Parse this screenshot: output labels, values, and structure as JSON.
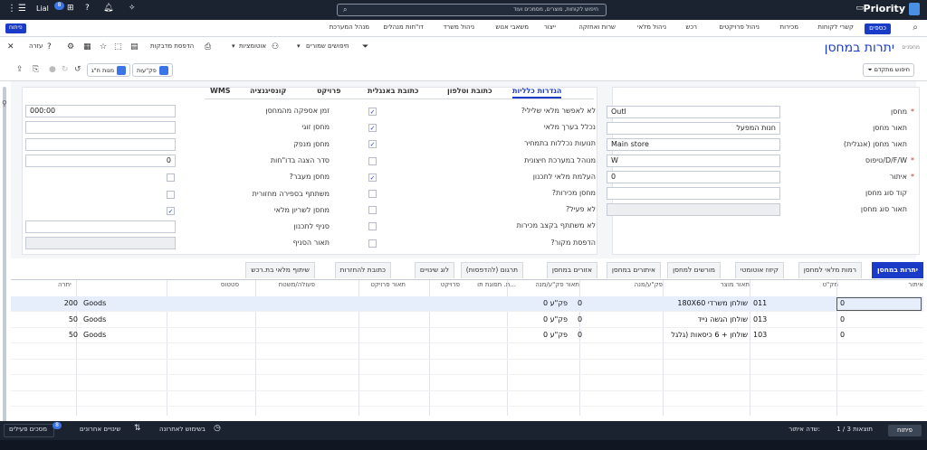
{
  "topbar": {
    "app_name": "Priority",
    "search_placeholder": "חיפוש לקוחות, מוצרים, מסמכים ועוד",
    "user_initials": "Lial",
    "badge_count": "8"
  },
  "menu": {
    "items": [
      "כספים",
      "קשרי לקוחות",
      "מכירות",
      "ניהול פרויקטים",
      "רכש",
      "ניהול מלאי",
      "שרות ואחזקה",
      "ייצור",
      "משאבי אנוש",
      "ניהול משרד",
      "דו\"חות מנהלים",
      "מנהל המערכת"
    ],
    "pill": "פיתוח"
  },
  "toolbar": {
    "title": "יתרות במחסן",
    "breadcrumb": "מחסנים",
    "saved_searches": "חיפושים שמורים",
    "automation": "אוטומציות",
    "print_labels": "הדפסת מדבקות",
    "help": "עזרה",
    "advanced_search": "חיפוש מתקדם",
    "btn_pakat": "פק\"עות",
    "btn_ch": "מנות ח\"ג"
  },
  "form_tabs": [
    "הגדרות כלליות",
    "כתובת וטלפון",
    "כתובת באנגלית",
    "פרויקט",
    "קונסיגנציה",
    "WMS"
  ],
  "right_fields": [
    {
      "label": "מחסן",
      "value": "Outl",
      "required": true,
      "readonly": false
    },
    {
      "label": "תאור מחסן",
      "value": "חנות המפעל",
      "required": false,
      "readonly": false
    },
    {
      "label": "תאור מחסן (אנגלית)",
      "value": "Main store",
      "required": false,
      "readonly": false
    },
    {
      "label": "D/F/W/טיפוס",
      "value": "W",
      "required": true,
      "readonly": false
    },
    {
      "label": "איתור",
      "value": "0",
      "required": true,
      "readonly": false
    },
    {
      "label": "קוד סוג מחסן",
      "value": "",
      "required": false,
      "readonly": false
    },
    {
      "label": "תאור סוג מחסן",
      "value": "",
      "required": false,
      "readonly": true
    }
  ],
  "middle_checks": [
    {
      "label": "לא לאפשר מלאי שלילי?",
      "checked": true
    },
    {
      "label": "נכלל בערך מלאי",
      "checked": true
    },
    {
      "label": "תנועות נכללות בתמחיר",
      "checked": true
    },
    {
      "label": "מנוהל במערכת חיצונית",
      "checked": false
    },
    {
      "label": "העלמת מלאי לתכנון",
      "checked": true
    },
    {
      "label": "מחסן מכירות?",
      "checked": false
    },
    {
      "label": "לא פעיל?",
      "checked": false
    },
    {
      "label": "לא משתתף בקצב מכירות",
      "checked": false
    },
    {
      "label": "הדפסת מקור?",
      "checked": false
    }
  ],
  "left_fields": [
    {
      "label": "זמן אספקה מהמחסן",
      "kind": "input",
      "value": "000:00"
    },
    {
      "label": "מחסן זוגי",
      "kind": "input",
      "value": ""
    },
    {
      "label": "מחסן מנפק",
      "kind": "input",
      "value": ""
    },
    {
      "label": "סדר הצגה בדו\"חות",
      "kind": "input",
      "value": "0"
    },
    {
      "label": "מחסן מעבר?",
      "kind": "check",
      "checked": false
    },
    {
      "label": "משתתף בספירה מחזורית",
      "kind": "check",
      "checked": false
    },
    {
      "label": "מחסן לשריון מלאי",
      "kind": "check",
      "checked": true
    },
    {
      "label": "סניף לתכנון",
      "kind": "input",
      "value": ""
    },
    {
      "label": "תאור הסניף",
      "kind": "input",
      "value": "",
      "readonly": true
    }
  ],
  "sub_tabs": [
    "יתרות במחסן",
    "רמות מלאי למחסן",
    "קיזוז אוטומטי",
    "מורשים למחסן",
    "איתורים במחסן",
    "אזורים במחסן",
    "תרגום (להדפסות)",
    "לוג שינויים",
    "כתובת להחזרות",
    "שיתוף מלאי בת.רכש"
  ],
  "grid": {
    "headers": [
      "איתור",
      "מק\"ט",
      "תאור מוצר",
      "פק\"ע/מנה",
      "תאור פק\"ע/מנה",
      "ת. תפוגת תו...",
      "פרויקט",
      "תאור פרויקט",
      "פעולה/משטח",
      "סטטוס",
      "יתרה"
    ],
    "rows": [
      {
        "location": "0",
        "sku": "011",
        "desc": "שולחן משרדי 180X60",
        "lot": "0",
        "lot_desc": "פק\"ע 0",
        "status": "Goods",
        "qty": "200"
      },
      {
        "location": "0",
        "sku": "013",
        "desc": "שולחן הגשה נייד",
        "lot": "0",
        "lot_desc": "פק\"ע 0",
        "status": "Goods",
        "qty": "50"
      },
      {
        "location": "0",
        "sku": "103",
        "desc": "שולחן + 6 כיסאות (גלגל",
        "lot": "0",
        "lot_desc": "פק\"ע 0",
        "status": "Goods",
        "qty": "50"
      }
    ]
  },
  "statusbar": {
    "dev": "פיתוח",
    "records": "1 / 3 תוצאות",
    "field_label": "שדה:",
    "field_value": "איתור",
    "recent_use": "בשימוש לאחרונה",
    "recent_changes": "שינויים אחרונים",
    "active_docs": "מסכים פעילים",
    "active_count": "8"
  },
  "colors": {
    "accent": "#1a3bc7",
    "topbar": "#1b2331"
  }
}
